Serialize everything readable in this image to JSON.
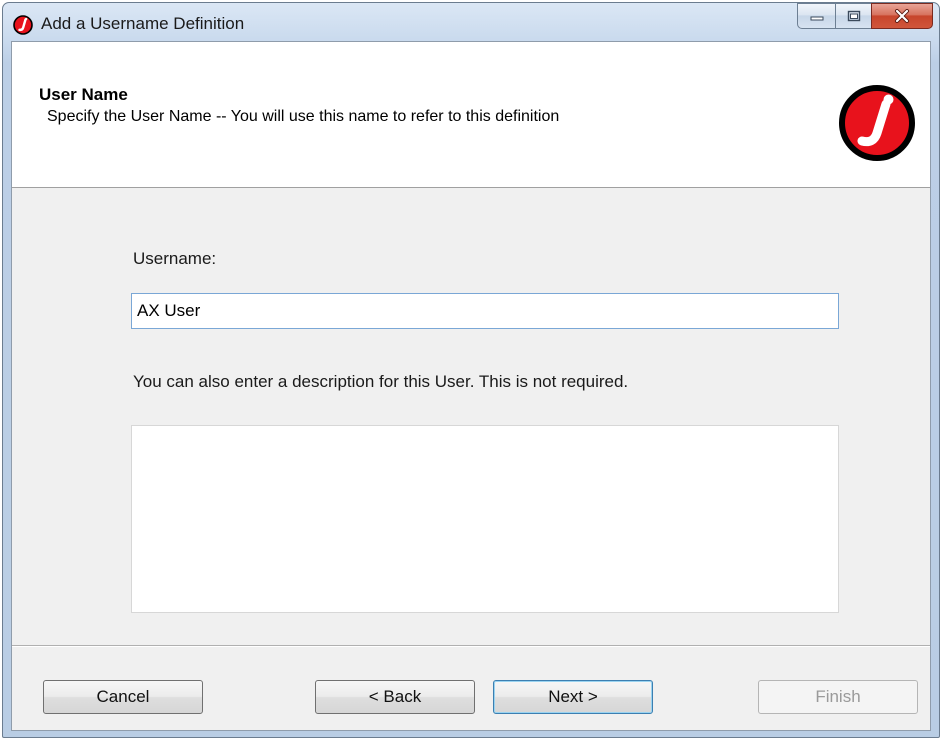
{
  "window": {
    "title": "Add a Username Definition",
    "app_icon": "j-logo-icon",
    "controls": [
      "minimize-icon",
      "maximize-icon",
      "close-icon"
    ]
  },
  "header": {
    "title": "User Name",
    "subtitle": "Specify the User Name -- You will use this name to refer to this definition",
    "logo": "j-logo-icon"
  },
  "form": {
    "username_label": "Username:",
    "username_value": "AX User",
    "description_label": "You can also enter a description for this User. This is not required.",
    "description_value": ""
  },
  "buttons": {
    "cancel": "Cancel",
    "back": "< Back",
    "next": "Next >",
    "finish": "Finish"
  },
  "colors": {
    "logo_red": "#e8121c",
    "logo_black": "#000000",
    "accent_border": "#7aa7d6"
  }
}
